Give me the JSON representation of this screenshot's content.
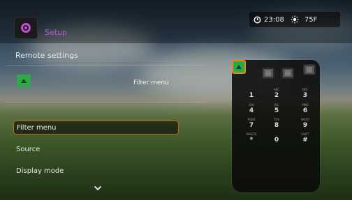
{
  "header": {
    "app_title": "Setup",
    "app_icon": "settings-icon",
    "time": "23:08",
    "temperature": "75F",
    "clock_icon": "clock-icon",
    "weather_icon": "sun-icon"
  },
  "section": {
    "title": "Remote settings",
    "remote_button_icon": "green-button-icon",
    "remote_button_value": "Filter menu"
  },
  "menu": {
    "items": [
      {
        "label": "Filter menu",
        "selected": true
      },
      {
        "label": "Source",
        "selected": false
      },
      {
        "label": "Display mode",
        "selected": false
      }
    ],
    "scroll_icon": "chevron-down-icon"
  },
  "remote": {
    "top_keys": [
      "green-key",
      "gray-key",
      "gray-key",
      "gray-key"
    ],
    "keys": [
      {
        "sub": "",
        "digit": "1"
      },
      {
        "sub": "ABC",
        "digit": "2"
      },
      {
        "sub": "DEF",
        "digit": "3"
      },
      {
        "sub": "GHI",
        "digit": "4"
      },
      {
        "sub": "JKL",
        "digit": "5"
      },
      {
        "sub": "MNO",
        "digit": "6"
      },
      {
        "sub": "PQRS",
        "digit": "7"
      },
      {
        "sub": "TUV",
        "digit": "8"
      },
      {
        "sub": "WXYZ",
        "digit": "9"
      },
      {
        "sub": "DELETE",
        "digit": "*"
      },
      {
        "sub": "",
        "digit": "0"
      },
      {
        "sub": "SHIFT",
        "digit": "#"
      }
    ]
  },
  "colors": {
    "accent": "#b85cd0",
    "selection_border": "#b86a1c",
    "green_button": "#2fa84a"
  }
}
